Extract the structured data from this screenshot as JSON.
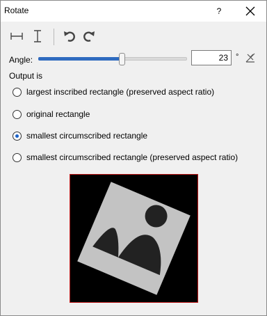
{
  "window": {
    "title": "Rotate",
    "help_label": "?"
  },
  "toolbar": {
    "buttons": [
      {
        "icon": "flip-horizontal-icon"
      },
      {
        "icon": "flip-vertical-icon"
      },
      {
        "icon": "rotate-left-icon"
      },
      {
        "icon": "rotate-right-icon"
      }
    ]
  },
  "angle": {
    "label": "Angle:",
    "value": "23",
    "unit": "°",
    "slider_fraction": 0.56,
    "reset_icon": "reset-angle-icon"
  },
  "output": {
    "label": "Output is",
    "selected_index": 2,
    "options": [
      {
        "label": "largest inscribed rectangle (preserved aspect ratio)"
      },
      {
        "label": "original rectangle"
      },
      {
        "label": "smallest circumscribed rectangle"
      },
      {
        "label": "smallest circumscribed rectangle (preserved aspect ratio)"
      }
    ]
  },
  "preview": {
    "image_icon": "image-placeholder-icon",
    "rotation_deg": 23,
    "frame_color": "#c01818",
    "background": "#000000",
    "image_color": "#c3c3c3",
    "glyph_color": "#222222"
  },
  "colors": {
    "accent": "#2f6bbf",
    "radio_selected": "#1c62c8"
  }
}
